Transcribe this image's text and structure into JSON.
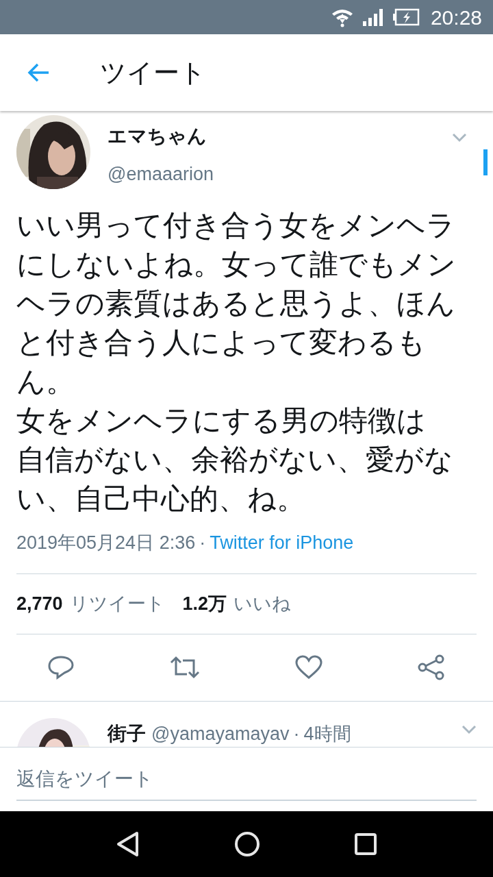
{
  "status_bar": {
    "time": "20:28"
  },
  "header": {
    "title": "ツイート"
  },
  "tweet": {
    "display_name": "エマちゃん",
    "handle": "@emaaarion",
    "paragraphs": [
      "いい男って付き合う女をメンヘラにしないよね。女って誰でもメンヘラの素質はあると思うよ、ほんと付き合う人によって変わるもん。",
      "女をメンヘラにする男の特徴は",
      "自信がない、余裕がない、愛がない、自己中心的、ね。"
    ],
    "timestamp": "2019年05月24日 2:36",
    "separator": "·",
    "source": "Twitter for iPhone",
    "retweet_count": "2,770",
    "retweet_label": "リツイート",
    "like_count": "1.2万",
    "like_label": "いいね"
  },
  "reply": {
    "display_name": "街子",
    "handle": "@yamayamayav",
    "separator": "·",
    "time": "4時間"
  },
  "reply_bar": {
    "placeholder": "返信をツイート"
  }
}
